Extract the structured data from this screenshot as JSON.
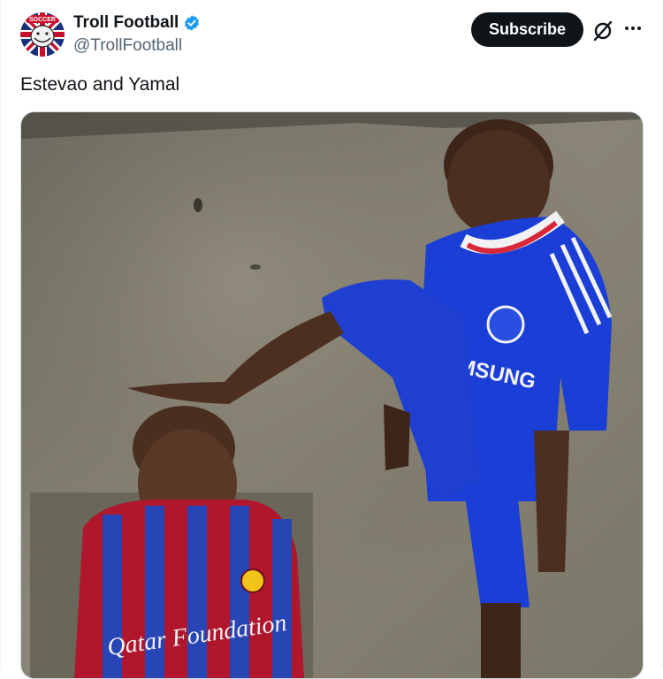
{
  "author": {
    "display_name": "Troll Football",
    "handle": "@TrollFootball",
    "verified": true,
    "avatar_icon": "troll-face-union-jack-avatar",
    "avatar_badge_text": "SOCCER"
  },
  "actions": {
    "subscribe_label": "Subscribe",
    "grok_icon": "grok-icon",
    "more_icon": "more-dots-icon"
  },
  "tweet": {
    "text": "Estevao and Yamal"
  },
  "media": {
    "type": "photo",
    "blue_jersey_sponsor": "SAMSUNG",
    "red_blue_jersey_sponsor": "Qatar Foundation"
  },
  "colors": {
    "accent_blue": "#1d9bf0",
    "subscribe_bg": "#0f1419",
    "handle_gray": "#536471",
    "chelsea_blue": "#1a3ed6",
    "barca_red": "#b0172d",
    "barca_blue": "#2845b5"
  }
}
